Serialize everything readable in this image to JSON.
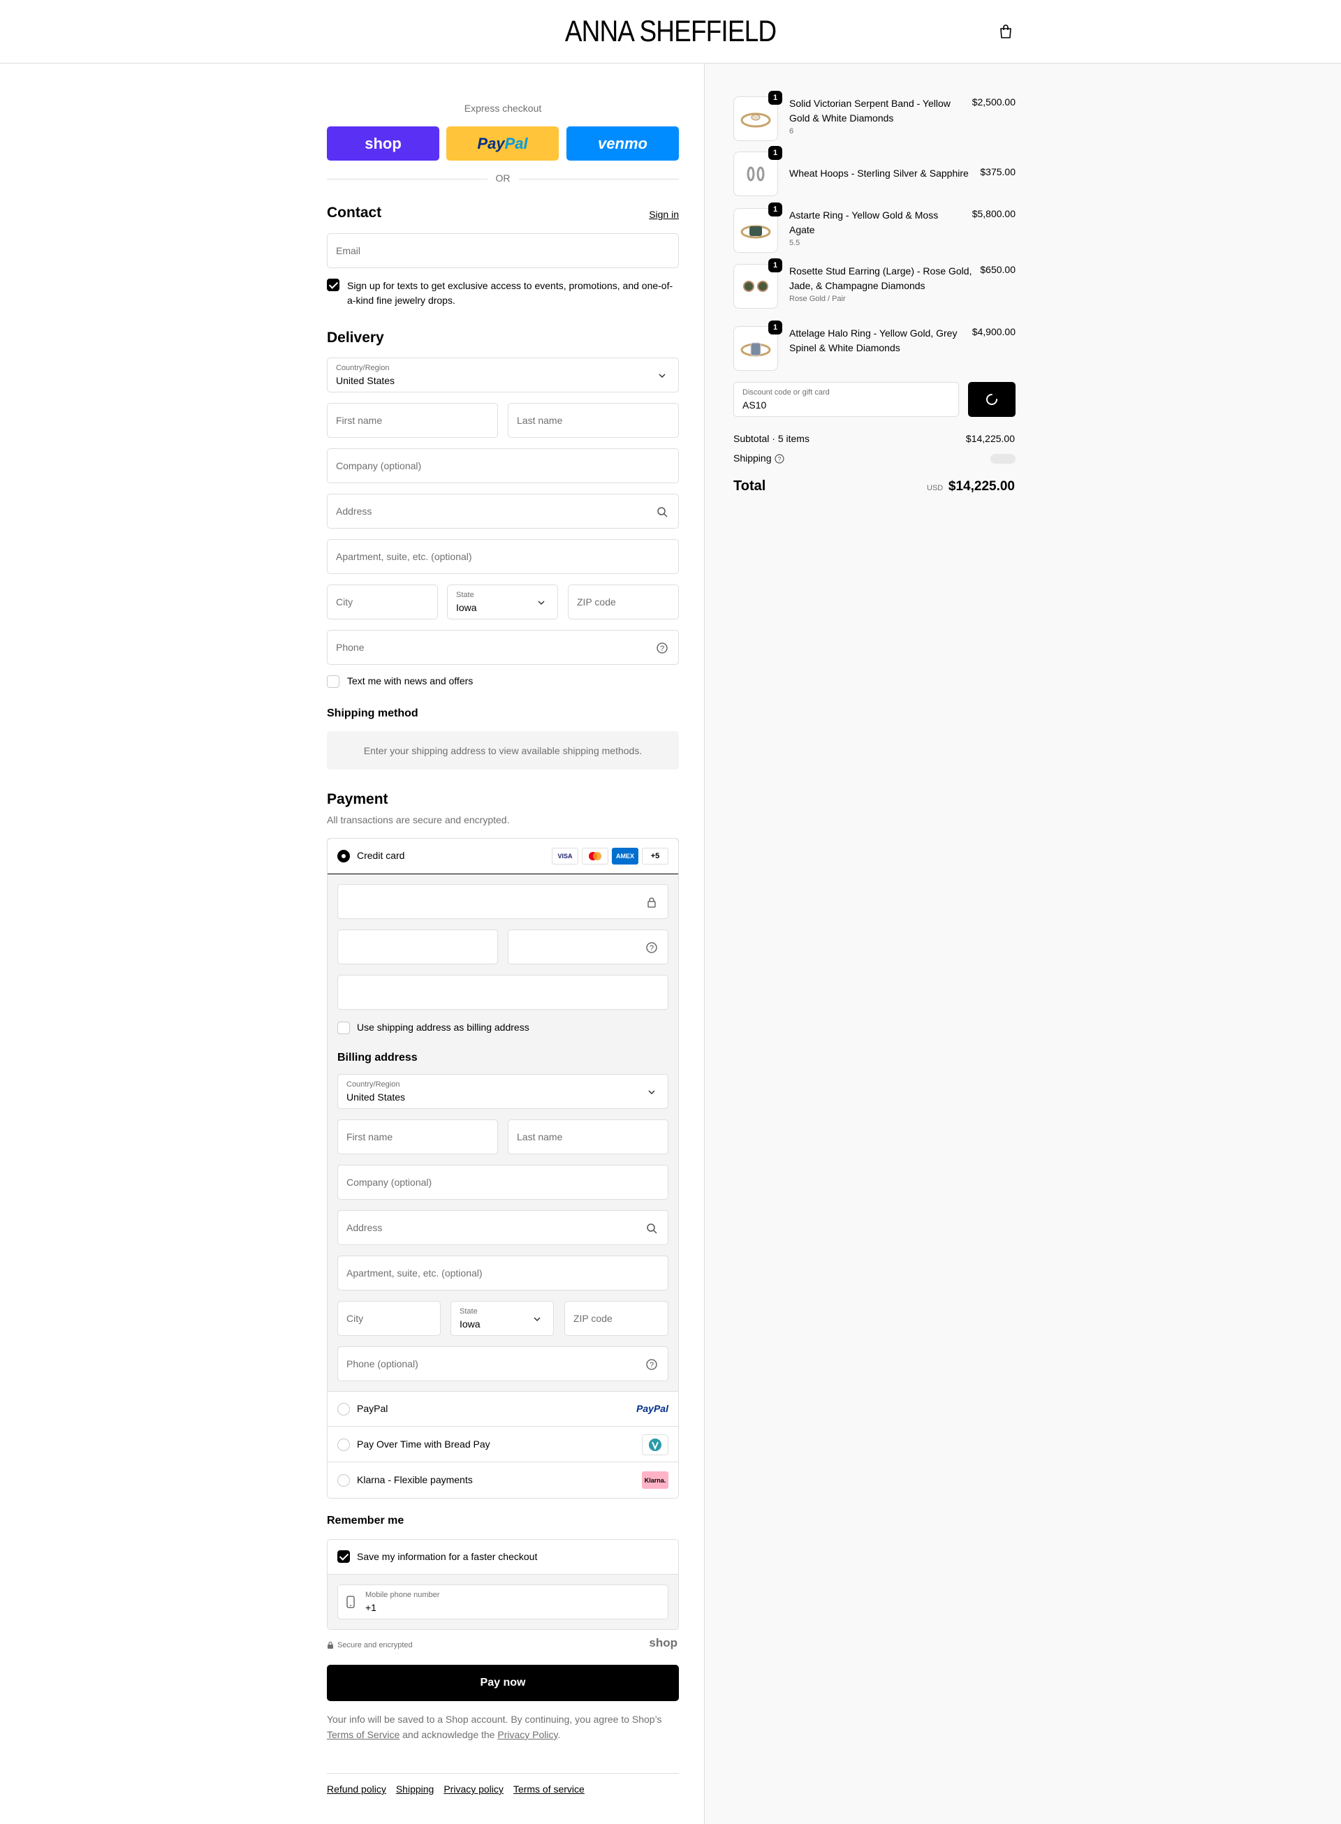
{
  "header": {
    "brand": "ANNA SHEFFIELD",
    "bag_icon": "shopping-bag-icon"
  },
  "express": {
    "label": "Express checkout",
    "shop": "shop",
    "paypal_a": "Pay",
    "paypal_b": "Pal",
    "venmo": "venmo",
    "or": "OR"
  },
  "contact": {
    "title": "Contact",
    "sign_in": "Sign in",
    "email_placeholder": "Email",
    "sms_optin": "Sign up for texts to get exclusive access to events, promotions, and one-of-a-kind fine jewelry drops."
  },
  "delivery": {
    "title": "Delivery",
    "country_label": "Country/Region",
    "country_value": "United States",
    "first_name": "First name",
    "last_name": "Last name",
    "company": "Company (optional)",
    "address": "Address",
    "apartment": "Apartment, suite, etc. (optional)",
    "city": "City",
    "state_label": "State",
    "state_value": "Iowa",
    "zip": "ZIP code",
    "phone": "Phone",
    "news_optin": "Text me with news and offers"
  },
  "shipping_method": {
    "title": "Shipping method",
    "notice": "Enter your shipping address to view available shipping methods."
  },
  "payment": {
    "title": "Payment",
    "subtitle": "All transactions are secure and encrypted.",
    "credit_card": "Credit card",
    "card_brands": [
      "VISA",
      "MC",
      "AMEX"
    ],
    "more_brands": "+5",
    "use_shipping": "Use shipping address as billing address",
    "billing_title": "Billing address",
    "billing": {
      "country_label": "Country/Region",
      "country_value": "United States",
      "first_name": "First name",
      "last_name": "Last name",
      "company": "Company (optional)",
      "address": "Address",
      "apartment": "Apartment, suite, etc. (optional)",
      "city": "City",
      "state_label": "State",
      "state_value": "Iowa",
      "zip": "ZIP code",
      "phone": "Phone (optional)"
    },
    "methods": [
      {
        "label": "PayPal",
        "logo": "PayPal"
      },
      {
        "label": "Pay Over Time with Bread Pay",
        "logo": "bread-pay-icon"
      },
      {
        "label": "Klarna - Flexible payments",
        "logo": "Klarna."
      }
    ]
  },
  "remember": {
    "title": "Remember me",
    "save_info": "Save my information for a faster checkout",
    "mobile_label": "Mobile phone number",
    "mobile_value": "+1",
    "secure": "Secure and encrypted",
    "shop_logo": "shop"
  },
  "pay_now": "Pay now",
  "legal": {
    "text1": "Your info will be saved to a Shop account. By continuing, you agree to Shop’s",
    "tos": "Terms of Service",
    "text2": "and acknowledge the",
    "privacy": "Privacy Policy",
    "end": "."
  },
  "footer": [
    "Refund policy",
    "Shipping",
    "Privacy policy",
    "Terms of service"
  ],
  "cart": {
    "items": [
      {
        "qty": "1",
        "name": "Solid Victorian Serpent Band - Yellow Gold & White Diamonds",
        "variant": "6",
        "price": "$2,500.00"
      },
      {
        "qty": "1",
        "name": "Wheat Hoops - Sterling Silver & Sapphire",
        "variant": "",
        "price": "$375.00"
      },
      {
        "qty": "1",
        "name": "Astarte Ring - Yellow Gold & Moss Agate",
        "variant": "5.5",
        "price": "$5,800.00"
      },
      {
        "qty": "1",
        "name": "Rosette Stud Earring (Large) - Rose Gold, Jade, & Champagne Diamonds",
        "variant": "Rose Gold / Pair",
        "price": "$650.00"
      },
      {
        "qty": "1",
        "name": "Attelage Halo Ring - Yellow Gold, Grey Spinel & White Diamonds",
        "variant": "",
        "price": "$4,900.00"
      }
    ],
    "discount_label": "Discount code or gift card",
    "discount_value": "AS10",
    "subtotal_label": "Subtotal · 5 items",
    "subtotal_value": "$14,225.00",
    "shipping_label": "Shipping",
    "total_label": "Total",
    "currency": "USD",
    "total_value": "$14,225.00"
  }
}
